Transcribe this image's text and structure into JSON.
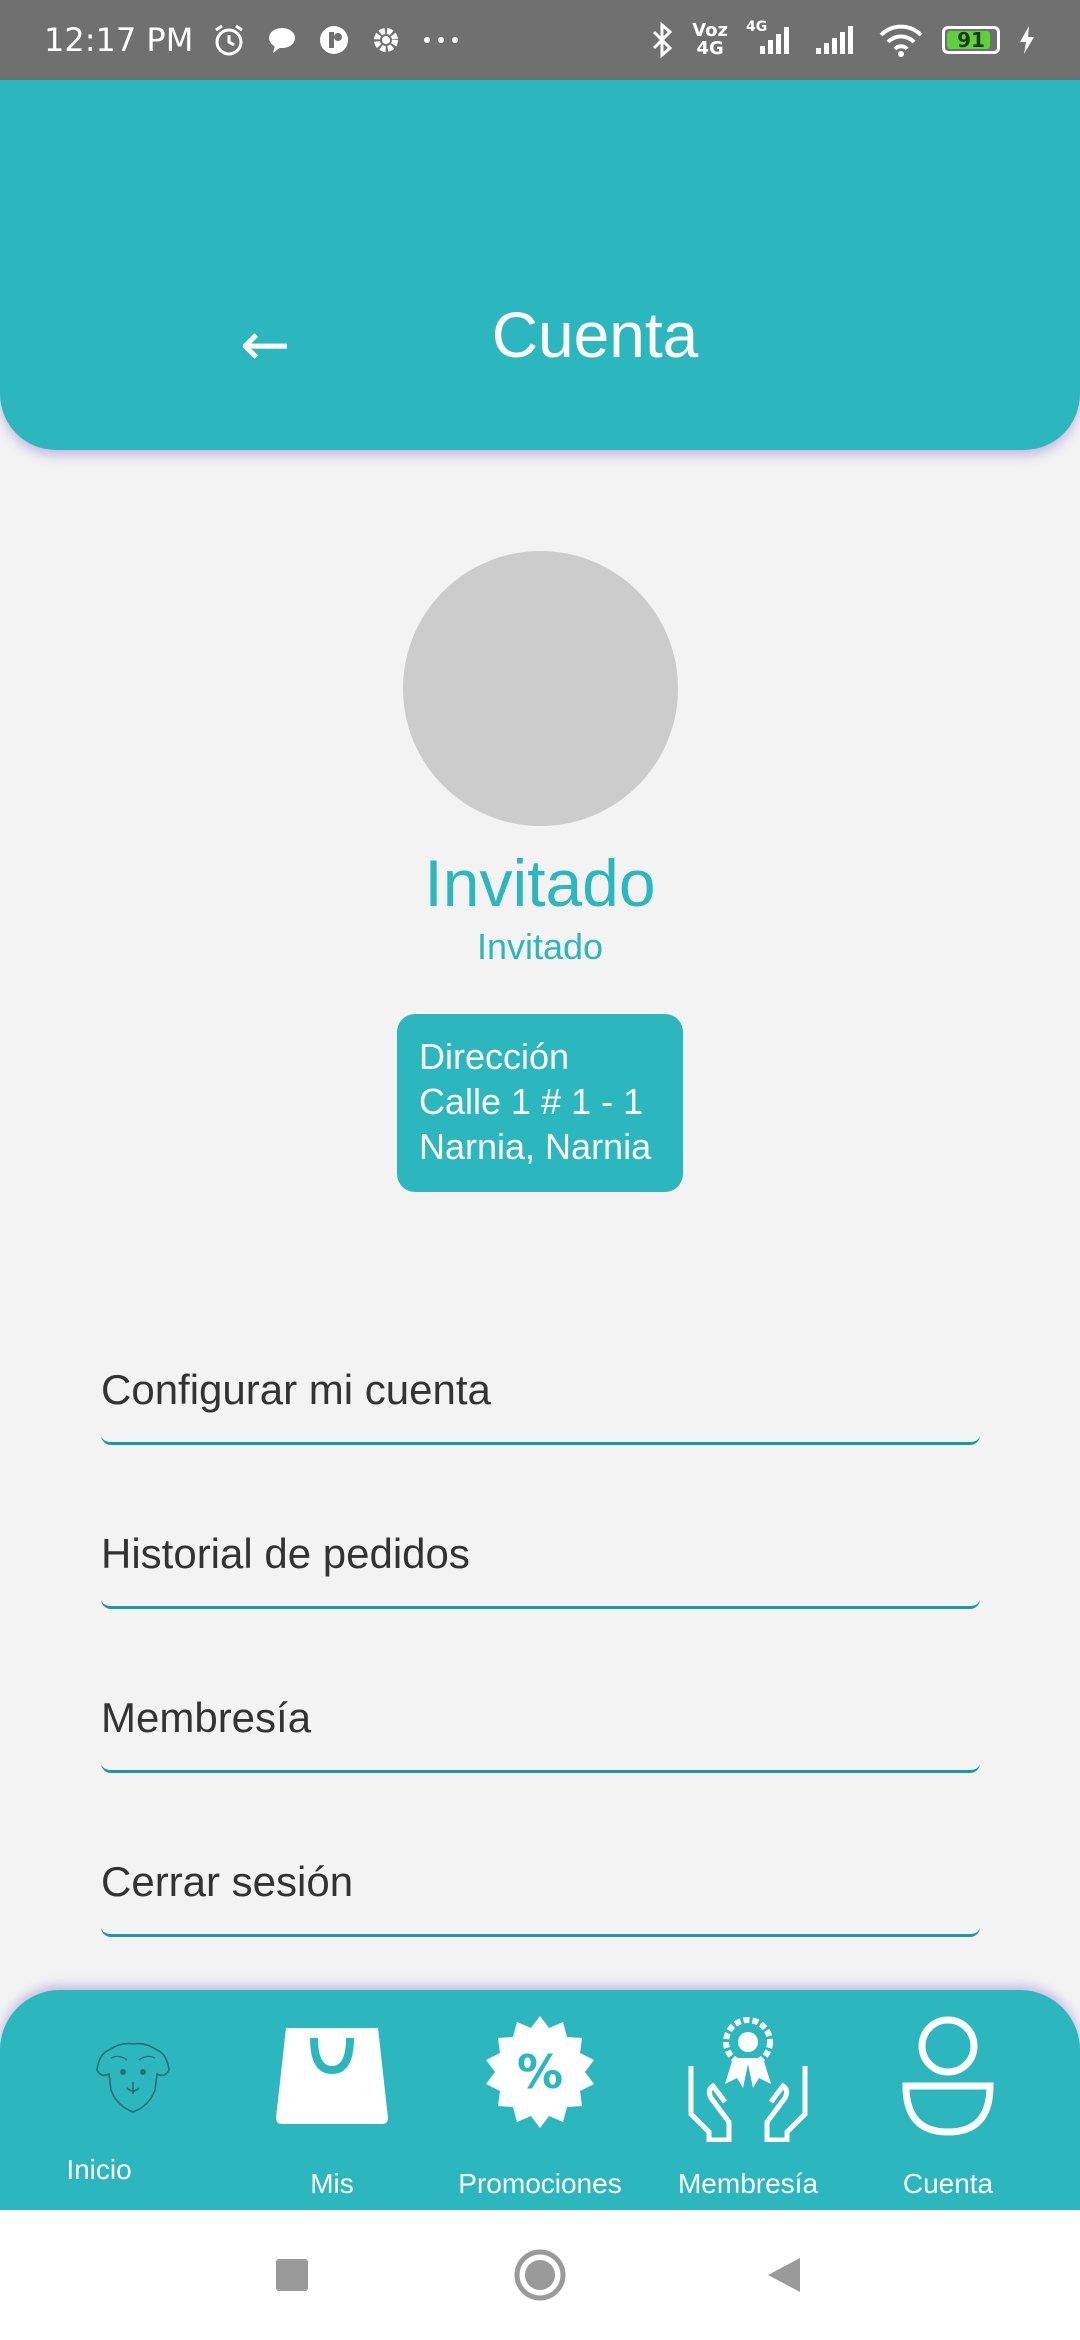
{
  "status_bar": {
    "time": "12:17 PM",
    "volte_top": "Voz",
    "volte_bottom": "4G",
    "network_type": "4G",
    "battery_level": "91",
    "battery_fraction": 0.91,
    "icons": [
      "alarm-icon",
      "chat-bubble-icon",
      "app-notification-icon",
      "settings-gear-icon",
      "more-dots-icon",
      "bluetooth-icon",
      "signal-icon",
      "signal-icon",
      "wifi-icon",
      "battery-icon",
      "charging-bolt-icon"
    ]
  },
  "header": {
    "title": "Cuenta",
    "back_symbol": "←",
    "color": "#2cb7be"
  },
  "profile": {
    "name": "Invitado",
    "role": "Invitado",
    "address_label": "Dirección",
    "address_line1": "Calle 1 # 1 - 1",
    "address_line2": "Narnia, Narnia"
  },
  "menu": {
    "items": [
      {
        "label": "Configurar mi cuenta"
      },
      {
        "label": "Historial de pedidos"
      },
      {
        "label": "Membresía"
      },
      {
        "label": "Cerrar sesión"
      }
    ]
  },
  "bottom_nav": {
    "items": [
      {
        "label": "Inicio",
        "icon": "dog-icon"
      },
      {
        "label": "Mis",
        "icon": "shopping-bag-icon"
      },
      {
        "label": "Promociones",
        "icon": "percent-badge-icon"
      },
      {
        "label": "Membresía",
        "icon": "award-hands-icon"
      },
      {
        "label": "Cuenta",
        "icon": "user-icon"
      }
    ]
  },
  "system_nav": {
    "icons": [
      "recents-square-icon",
      "home-circle-icon",
      "back-triangle-icon"
    ]
  }
}
